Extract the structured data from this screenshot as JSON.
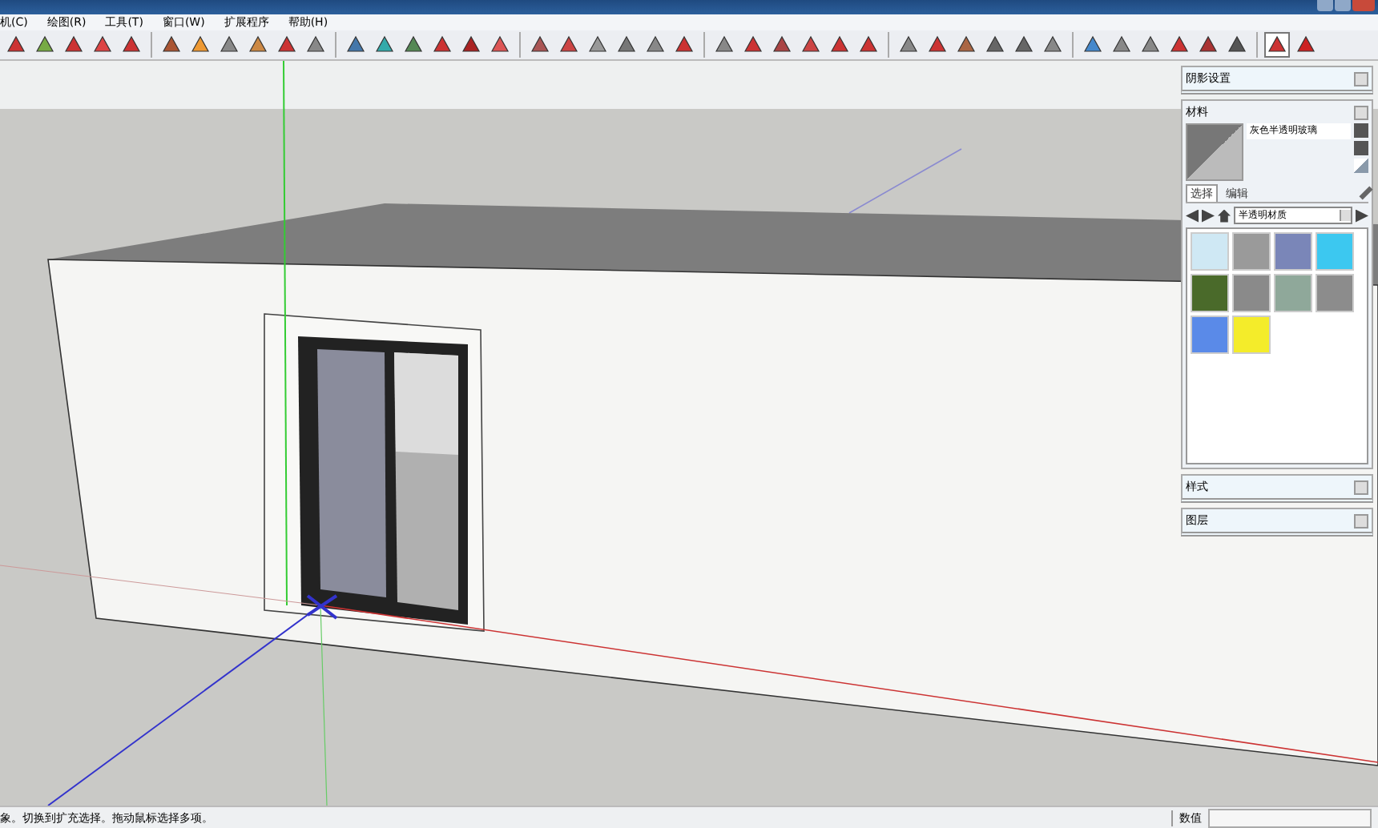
{
  "menu": [
    "机(C)",
    "绘图(R)",
    "工具(T)",
    "窗口(W)",
    "扩展程序",
    "帮助(H)"
  ],
  "tray": {
    "panels_top": [
      {
        "title": "阴影设置",
        "expanded": false
      }
    ],
    "materials": {
      "title": "材料",
      "name": "灰色半透明玻璃",
      "tabs": [
        {
          "label": "选择",
          "selected": true
        },
        {
          "label": "编辑",
          "selected": false
        }
      ],
      "library": "半透明材质",
      "swatches": [
        {
          "color": "#cfe8f4"
        },
        {
          "color": "#9a9a9a"
        },
        {
          "color": "#7a86b8"
        },
        {
          "color": "#3cc8f0"
        },
        {
          "color": "#4a6a2a"
        },
        {
          "color": "#8a8a8a"
        },
        {
          "color": "#8fa89a"
        },
        {
          "color": "#8c8c8c"
        },
        {
          "color": "#5a8ae8"
        },
        {
          "color": "#f4ec2a"
        }
      ]
    },
    "panels_bottom": [
      {
        "title": "样式",
        "expanded": false
      },
      {
        "title": "图层",
        "expanded": false
      }
    ]
  },
  "status_bar": {
    "message": "象。切换到扩充选择。拖动鼠标选择多项。",
    "value_label": "数值"
  }
}
